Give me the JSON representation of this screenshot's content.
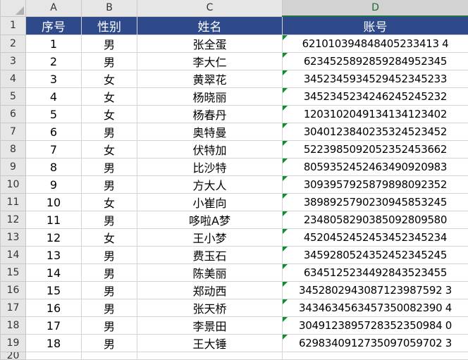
{
  "columns": [
    "A",
    "B",
    "C",
    "D"
  ],
  "header": {
    "row_num": "1",
    "seq": "序号",
    "gender": "性别",
    "name": "姓名",
    "account": "账号"
  },
  "rows": [
    {
      "row_num": "2",
      "seq": "1",
      "gender": "男",
      "name": "张全蛋",
      "account": "621010394848405233413 4"
    },
    {
      "row_num": "3",
      "seq": "2",
      "gender": "男",
      "name": "李大仁",
      "account": "6234525892859284952345"
    },
    {
      "row_num": "4",
      "seq": "3",
      "gender": "女",
      "name": "黄翠花",
      "account": "3452345934529452345233"
    },
    {
      "row_num": "5",
      "seq": "4",
      "gender": "女",
      "name": "杨晓丽",
      "account": "3452345234246245245232"
    },
    {
      "row_num": "6",
      "seq": "5",
      "gender": "女",
      "name": "杨春丹",
      "account": "1203102049134134123402"
    },
    {
      "row_num": "7",
      "seq": "6",
      "gender": "男",
      "name": "奥特曼",
      "account": "3040123840235324523452"
    },
    {
      "row_num": "8",
      "seq": "7",
      "gender": "女",
      "name": "伏特加",
      "account": "5223985092052352453662"
    },
    {
      "row_num": "9",
      "seq": "8",
      "gender": "男",
      "name": "比沙特",
      "account": "8059352452463490920983"
    },
    {
      "row_num": "10",
      "seq": "9",
      "gender": "男",
      "name": "方大人",
      "account": "3093957925879898092352"
    },
    {
      "row_num": "11",
      "seq": "10",
      "gender": "女",
      "name": "小崔向",
      "account": "3898925790230945853245"
    },
    {
      "row_num": "12",
      "seq": "11",
      "gender": "男",
      "name": "哆啦A梦",
      "account": "2348058290385092809580"
    },
    {
      "row_num": "13",
      "seq": "12",
      "gender": "女",
      "name": "王小梦",
      "account": "4520452452453452345234"
    },
    {
      "row_num": "14",
      "seq": "13",
      "gender": "男",
      "name": "费玉石",
      "account": "3459280524352452345245"
    },
    {
      "row_num": "15",
      "seq": "14",
      "gender": "男",
      "name": "陈美丽",
      "account": "6345125234492843523455"
    },
    {
      "row_num": "16",
      "seq": "15",
      "gender": "男",
      "name": "郑动西",
      "account": "3452802943087123987592 3"
    },
    {
      "row_num": "17",
      "seq": "16",
      "gender": "男",
      "name": "张天桥",
      "account": "3434634563457350082390 4"
    },
    {
      "row_num": "18",
      "seq": "17",
      "gender": "男",
      "name": "李景田",
      "account": "3049123895728352350984 0"
    },
    {
      "row_num": "19",
      "seq": "18",
      "gender": "男",
      "name": "王大锤",
      "account": "6298340912735097059702 3"
    }
  ],
  "partial_row_num": "20",
  "colors": {
    "header_bg": "#2f4a8a",
    "header_text": "#ffffff",
    "selected_column_accent": "#217346",
    "text_indicator": "#0a8f2f"
  }
}
